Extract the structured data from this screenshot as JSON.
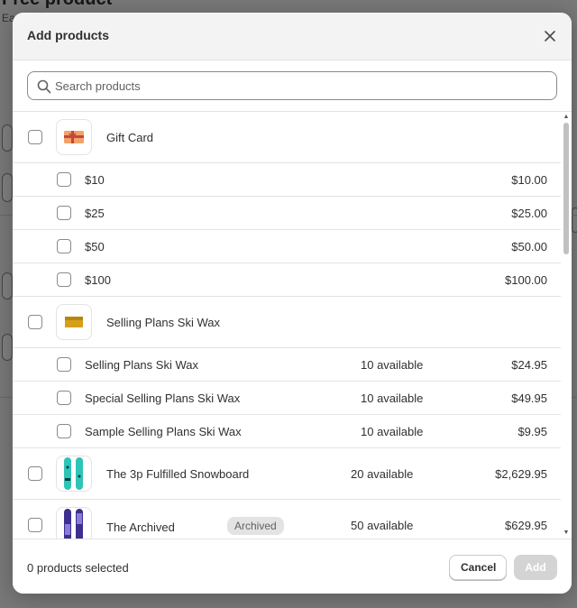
{
  "background": {
    "title": "Free product",
    "subtitle": "Ea"
  },
  "modal": {
    "title": "Add products",
    "close_icon": "close-icon"
  },
  "search": {
    "placeholder": "Search products",
    "value": ""
  },
  "products": [
    {
      "name": "Gift Card",
      "thumb": "gift-card-image",
      "variants": [
        {
          "name": "$10",
          "price": "$10.00"
        },
        {
          "name": "$25",
          "price": "$25.00"
        },
        {
          "name": "$50",
          "price": "$50.00"
        },
        {
          "name": "$100",
          "price": "$100.00"
        }
      ]
    },
    {
      "name": "Selling Plans Ski Wax",
      "thumb": "ski-wax-image",
      "variants": [
        {
          "name": "Selling Plans Ski Wax",
          "available": "10 available",
          "price": "$24.95"
        },
        {
          "name": "Special Selling Plans Ski Wax",
          "available": "10 available",
          "price": "$49.95"
        },
        {
          "name": "Sample Selling Plans Ski Wax",
          "available": "10 available",
          "price": "$9.95"
        }
      ]
    },
    {
      "name": "The 3p Fulfilled Snowboard",
      "thumb": "snowboard-teal-image",
      "available": "20 available",
      "price": "$2,629.95"
    },
    {
      "name": "The Archived Snowboard",
      "thumb": "snowboard-purple-image",
      "badge": "Archived",
      "available": "50 available",
      "price": "$629.95"
    }
  ],
  "footer": {
    "selected_text": "0 products selected",
    "cancel_label": "Cancel",
    "add_label": "Add"
  },
  "colors": {
    "overlay": "#000000",
    "border": "#e3e3e3",
    "badge_bg": "#e3e3e3",
    "add_disabled": "#d4d4d4"
  }
}
